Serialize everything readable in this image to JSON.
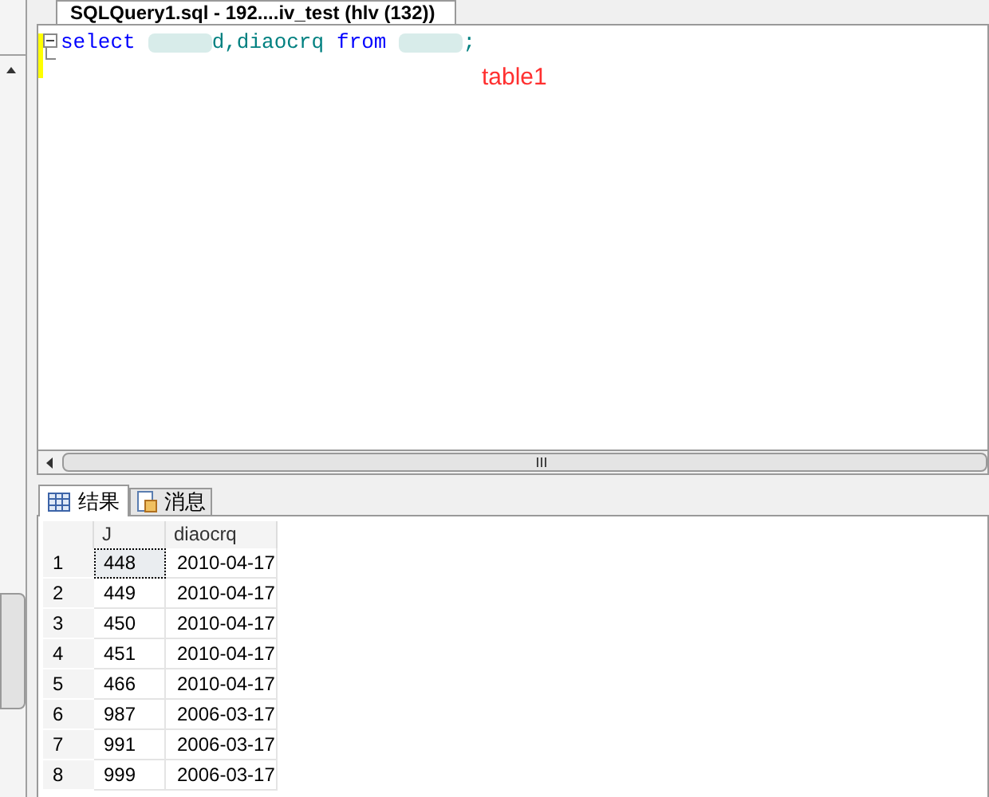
{
  "editor_tab": {
    "title": "SQLQuery1.sql - 192....iv_test (hlv (132))"
  },
  "query": {
    "tokens": [
      {
        "kind": "keyword",
        "text": "select"
      },
      {
        "kind": "blurred"
      },
      {
        "kind": "plain",
        "text": "d,diaocrq"
      },
      {
        "kind": "keyword",
        "text": "from"
      },
      {
        "kind": "blurred"
      },
      {
        "kind": "plain",
        "text": ";"
      }
    ]
  },
  "annotation": "table1",
  "result_tabs": [
    {
      "label": "结果",
      "selected": true
    },
    {
      "label": "消息",
      "selected": false
    }
  ],
  "grid": {
    "columns": [
      "J",
      "diaocrq"
    ],
    "rows": [
      {
        "num": "1",
        "cells": [
          "448",
          "2010-04-17"
        ],
        "selected": true
      },
      {
        "num": "2",
        "cells": [
          "449",
          "2010-04-17"
        ],
        "selected": false
      },
      {
        "num": "3",
        "cells": [
          "450",
          "2010-04-17"
        ],
        "selected": false
      },
      {
        "num": "4",
        "cells": [
          "451",
          "2010-04-17"
        ],
        "selected": false
      },
      {
        "num": "5",
        "cells": [
          "466",
          "2010-04-17"
        ],
        "selected": false
      },
      {
        "num": "6",
        "cells": [
          "987",
          "2006-03-17"
        ],
        "selected": false
      },
      {
        "num": "7",
        "cells": [
          "991",
          "2006-03-17"
        ],
        "selected": false
      },
      {
        "num": "8",
        "cells": [
          "999",
          "2006-03-17"
        ],
        "selected": false
      }
    ]
  }
}
